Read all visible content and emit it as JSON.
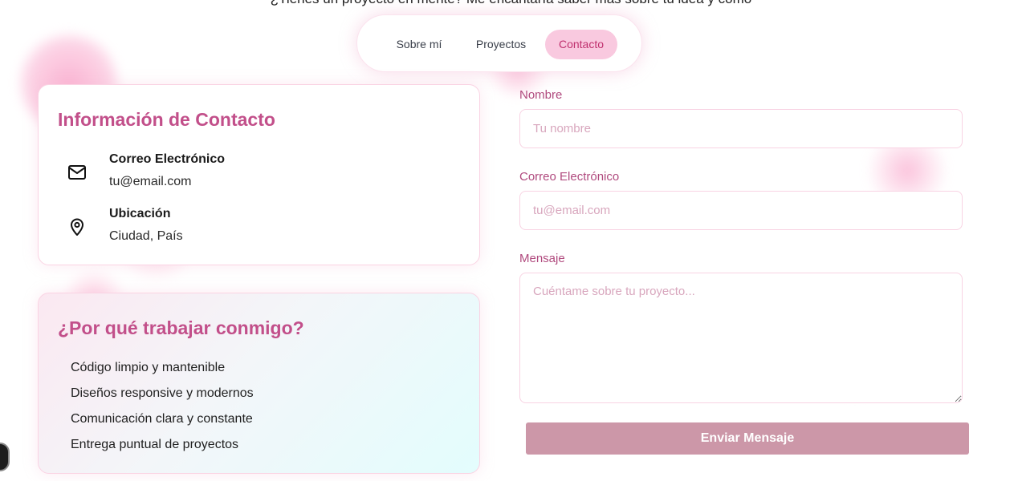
{
  "intro_text": "¿Tienes un proyecto en mente? Me encantaría saber más sobre tu idea y cómo",
  "nav": {
    "items": [
      {
        "label": "Sobre mí"
      },
      {
        "label": "Proyectos"
      },
      {
        "label": "Contacto",
        "active": true
      }
    ]
  },
  "contact_info": {
    "title": "Información de Contacto",
    "email": {
      "icon": "mail-icon",
      "label": "Correo Electrónico",
      "value": "tu@email.com"
    },
    "location": {
      "icon": "map-pin-icon",
      "label": "Ubicación",
      "value": "Ciudad, País"
    }
  },
  "why": {
    "title": "¿Por qué trabajar conmigo?",
    "items": [
      "Código limpio y mantenible",
      "Diseños responsive y modernos",
      "Comunicación clara y constante",
      "Entrega puntual de proyectos"
    ]
  },
  "form": {
    "name_label": "Nombre",
    "name_placeholder": "Tu nombre",
    "email_label": "Correo Electrónico",
    "email_placeholder": "tu@email.com",
    "message_label": "Mensaje",
    "message_placeholder": "Cuéntame sobre tu proyecto...",
    "submit_label": "Enviar Mensaje"
  },
  "colors": {
    "accent": "#c24f8a",
    "nav_active_bg": "#f9c9df",
    "button_bg": "#cc97a8",
    "border": "#f8d3e3"
  }
}
